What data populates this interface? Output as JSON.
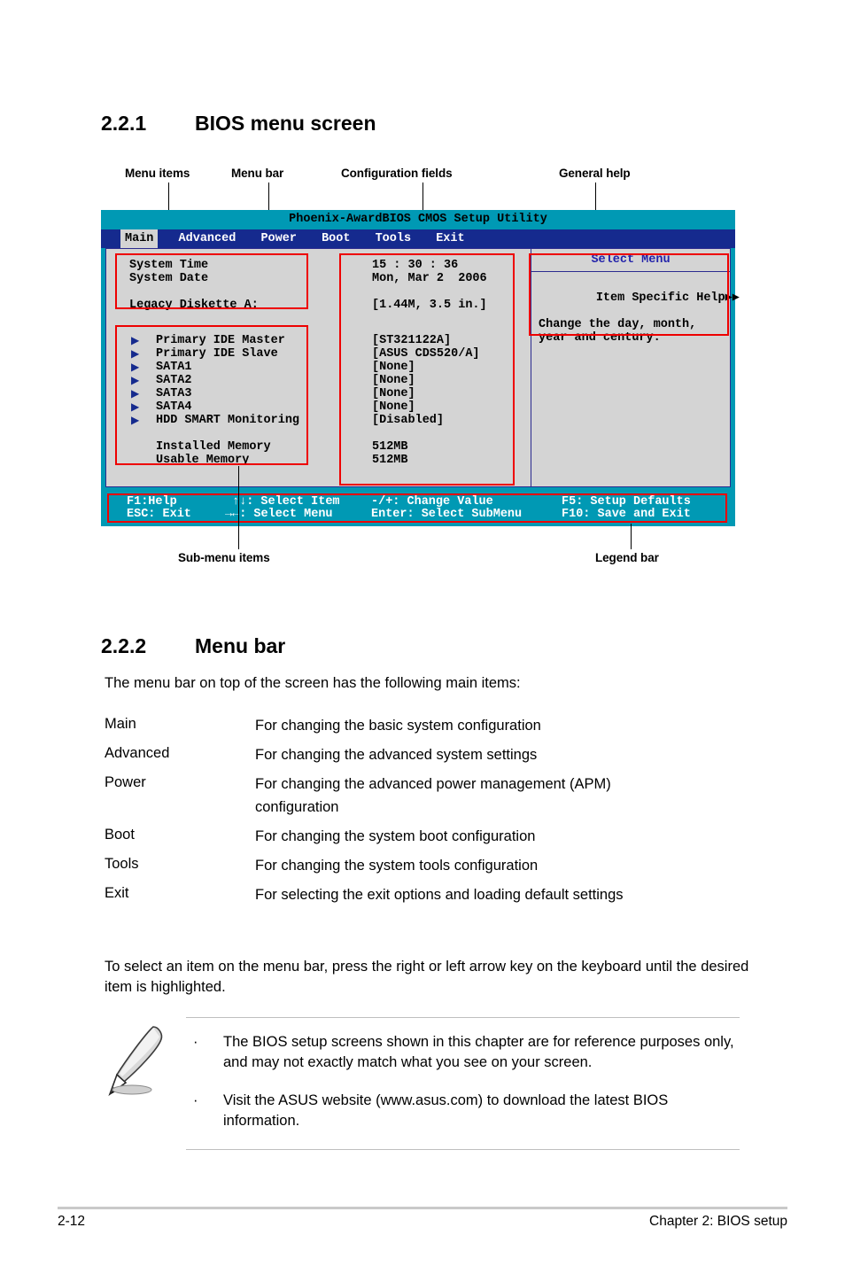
{
  "section_1": {
    "number": "2.2.1",
    "title": "BIOS menu screen"
  },
  "callouts": {
    "menu_items": "Menu items",
    "menu_bar": "Menu bar",
    "configuration_fields": "Configuration fields",
    "general_help": "General help",
    "sub_menu_items": "Sub-menu items",
    "legend_bar": "Legend bar"
  },
  "bios": {
    "title": "Phoenix-AwardBIOS CMOS Setup Utility",
    "menu_bar": [
      {
        "label": "Main",
        "active": true
      },
      {
        "label": "Advanced",
        "active": false
      },
      {
        "label": "Power",
        "active": false
      },
      {
        "label": "Boot",
        "active": false
      },
      {
        "label": "Tools",
        "active": false
      },
      {
        "label": "Exit",
        "active": false
      }
    ],
    "items_top": [
      {
        "label": "System Time",
        "value": "15 : 30 : 36",
        "submenu": false
      },
      {
        "label": "System Date",
        "value": "Mon, Mar 2  2006",
        "submenu": false
      },
      {
        "label": "Legacy Diskette A:",
        "value": "[1.44M, 3.5 in.]",
        "submenu": false
      }
    ],
    "items_sub": [
      {
        "label": "Primary IDE Master",
        "value": "[ST321122A]",
        "submenu": true
      },
      {
        "label": "Primary IDE Slave",
        "value": "[ASUS CDS520/A]",
        "submenu": true
      },
      {
        "label": "SATA1",
        "value": "[None]",
        "submenu": true
      },
      {
        "label": "SATA2",
        "value": "[None]",
        "submenu": true
      },
      {
        "label": "SATA3",
        "value": "[None]",
        "submenu": true
      },
      {
        "label": "SATA4",
        "value": "[None]",
        "submenu": true
      },
      {
        "label": "HDD SMART Monitoring",
        "value": "[Disabled]",
        "submenu": true
      }
    ],
    "items_memory": [
      {
        "label": "Installed Memory",
        "value": "512MB",
        "submenu": false
      },
      {
        "label": "Usable Memory",
        "value": "512MB",
        "submenu": false
      }
    ],
    "help": {
      "title": "Select Menu",
      "heading": "Item Specific Help",
      "heading_arrows": "▶▶",
      "body": "Change the day, month,\nyear and century."
    },
    "legend": {
      "row1": [
        "F1:Help",
        "↑↓: Select Item",
        "-/+: Change Value",
        "F5: Setup Defaults"
      ],
      "row2": [
        "ESC: Exit",
        "→←: Select Menu",
        "Enter: Select SubMenu",
        "F10: Save and Exit"
      ]
    },
    "colors": {
      "title_bar": "#0099b4",
      "menu_bar": "#152a8e",
      "body": "#d4d4d4",
      "highlight": "#d4d4d4",
      "help_title": "#2222aa",
      "annotation": "#ee0000"
    }
  },
  "section_2": {
    "number": "2.2.2",
    "title": "Menu bar",
    "intro": "The menu bar on top of the screen has the following main items:",
    "entries": [
      {
        "term": "Main",
        "desc": "For changing the basic system configuration"
      },
      {
        "term": "Advanced",
        "desc": "For changing the advanced system settings"
      },
      {
        "term": "Power",
        "desc": "For changing the advanced power management (APM) configuration"
      },
      {
        "term": "Boot",
        "desc": "For changing the system boot configuration"
      },
      {
        "term": "Tools",
        "desc": "For changing the system tools configuration"
      },
      {
        "term": "Exit",
        "desc": "For selecting the exit options and loading default settings"
      }
    ],
    "outro": "To select an item on the menu bar, press the right or left arrow key on the keyboard until the desired item is highlighted."
  },
  "note": {
    "bullet": "·",
    "items": [
      "The BIOS setup screens shown in this chapter are for reference purposes only, and may not exactly match what you see on your screen.",
      "Visit the ASUS website (www.asus.com) to download the latest BIOS information."
    ]
  },
  "footer": {
    "page": "2-12",
    "chapter": "Chapter 2: BIOS setup"
  }
}
